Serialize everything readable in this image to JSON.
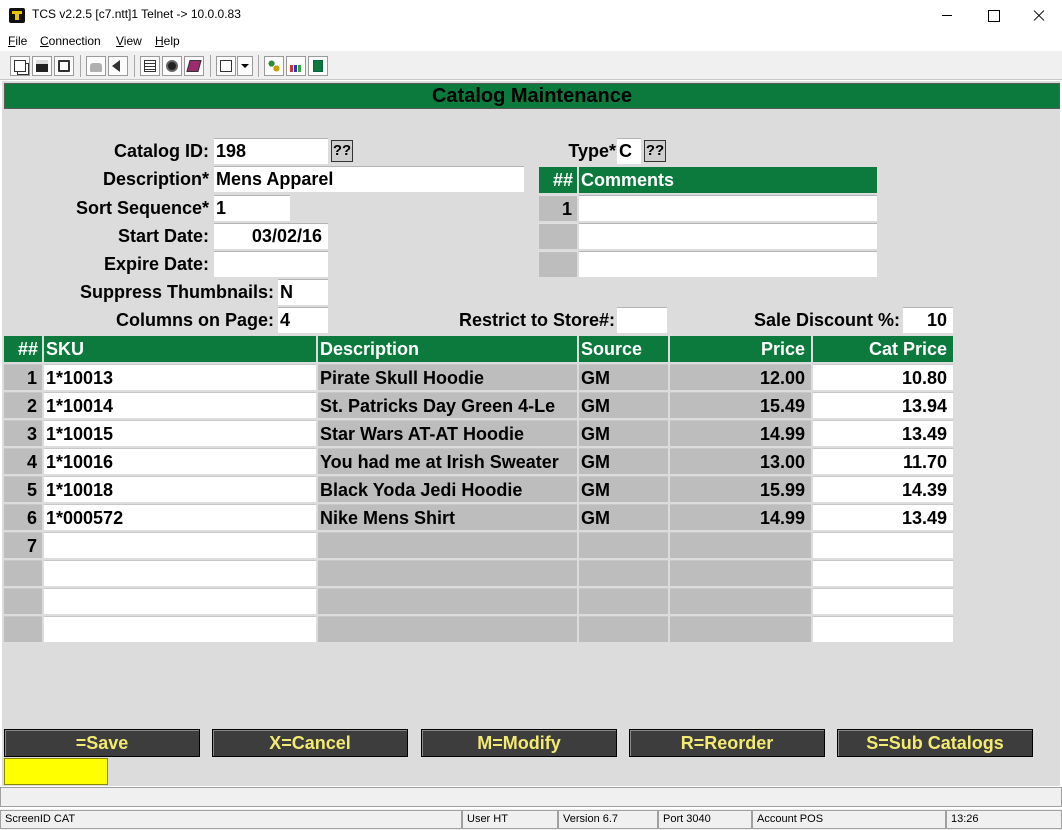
{
  "window": {
    "title": "TCS v2.2.5 [c7.ntt]1 Telnet -> 10.0.0.83",
    "menu": [
      {
        "key": "F",
        "rest": "ile"
      },
      {
        "key": "C",
        "rest": "onnection"
      },
      {
        "key": "V",
        "rest": "iew"
      },
      {
        "key": "H",
        "rest": "elp"
      }
    ]
  },
  "toolbar": {
    "icons": [
      "copy-icon",
      "save-icon",
      "print-icon",
      "lock-icon",
      "sound-icon",
      "properties-icon",
      "monitor-icon",
      "book-icon",
      "paste-icon",
      "dropdown-arrow-icon",
      "network-icon",
      "chart-icon",
      "calculator-icon"
    ]
  },
  "screen": {
    "header": "Catalog Maintenance",
    "form": {
      "catalog_id_label": "Catalog ID:",
      "catalog_id": "198",
      "lookup_label": "??",
      "description_label": "Description*",
      "description": "Mens Apparel",
      "sort_sequence_label": "Sort Sequence*",
      "sort_sequence": "1",
      "start_date_label": "Start Date:",
      "start_date": "03/02/16",
      "expire_date_label": "Expire Date:",
      "expire_date": "",
      "suppress_thumbnails_label": "Suppress Thumbnails:",
      "suppress_thumbnails": "N",
      "columns_on_page_label": "Columns on Page:",
      "columns_on_page": "4",
      "type_label": "Type*",
      "type": "C",
      "restrict_store_label": "Restrict to Store#:",
      "restrict_store": "",
      "sale_discount_label": "Sale Discount %:",
      "sale_discount": "10"
    },
    "comments": {
      "headers": [
        "##",
        "Comments"
      ],
      "rows": [
        {
          "num": "1",
          "text": ""
        },
        {
          "num": "",
          "text": ""
        },
        {
          "num": "",
          "text": ""
        }
      ]
    },
    "items": {
      "headers": [
        "##",
        "SKU",
        "Description",
        "Source",
        "Price",
        "Cat Price"
      ],
      "rows": [
        {
          "num": "1",
          "sku": "1*10013",
          "desc": "Pirate Skull Hoodie",
          "source": "GM",
          "price": "12.00",
          "cat_price": "10.80"
        },
        {
          "num": "2",
          "sku": "1*10014",
          "desc": "St. Patricks Day Green 4-Le",
          "source": "GM",
          "price": "15.49",
          "cat_price": "13.94"
        },
        {
          "num": "3",
          "sku": "1*10015",
          "desc": "Star Wars AT-AT Hoodie",
          "source": "GM",
          "price": "14.99",
          "cat_price": "13.49"
        },
        {
          "num": "4",
          "sku": "1*10016",
          "desc": "You had me at Irish Sweater",
          "source": "GM",
          "price": "13.00",
          "cat_price": "11.70"
        },
        {
          "num": "5",
          "sku": "1*10018",
          "desc": "Black Yoda Jedi Hoodie",
          "source": "GM",
          "price": "15.99",
          "cat_price": "14.39"
        },
        {
          "num": "6",
          "sku": "1*000572",
          "desc": "Nike Mens Shirt",
          "source": "GM",
          "price": "14.99",
          "cat_price": "13.49"
        },
        {
          "num": "7",
          "sku": "",
          "desc": "",
          "source": "",
          "price": "",
          "cat_price": ""
        },
        {
          "num": "",
          "sku": "",
          "desc": "",
          "source": "",
          "price": "",
          "cat_price": ""
        },
        {
          "num": "",
          "sku": "",
          "desc": "",
          "source": "",
          "price": "",
          "cat_price": ""
        },
        {
          "num": "",
          "sku": "",
          "desc": "",
          "source": "",
          "price": "",
          "cat_price": ""
        }
      ]
    },
    "function_keys": [
      "=Save",
      "X=Cancel",
      "M=Modify",
      "R=Reorder",
      "S=Sub Catalogs"
    ],
    "command_input": ""
  },
  "statusbar": {
    "panes": [
      "ScreenID CAT",
      "User HT",
      "Version 6.7",
      "Port 3040",
      "Account POS",
      "13:26"
    ]
  },
  "colors": {
    "header_green": "#0b7a3c",
    "screen_gray": "#dcdcdc",
    "fkey_bg": "#3d3d3d",
    "fkey_text": "#f3ea71",
    "command_yellow": "#ffff00"
  }
}
